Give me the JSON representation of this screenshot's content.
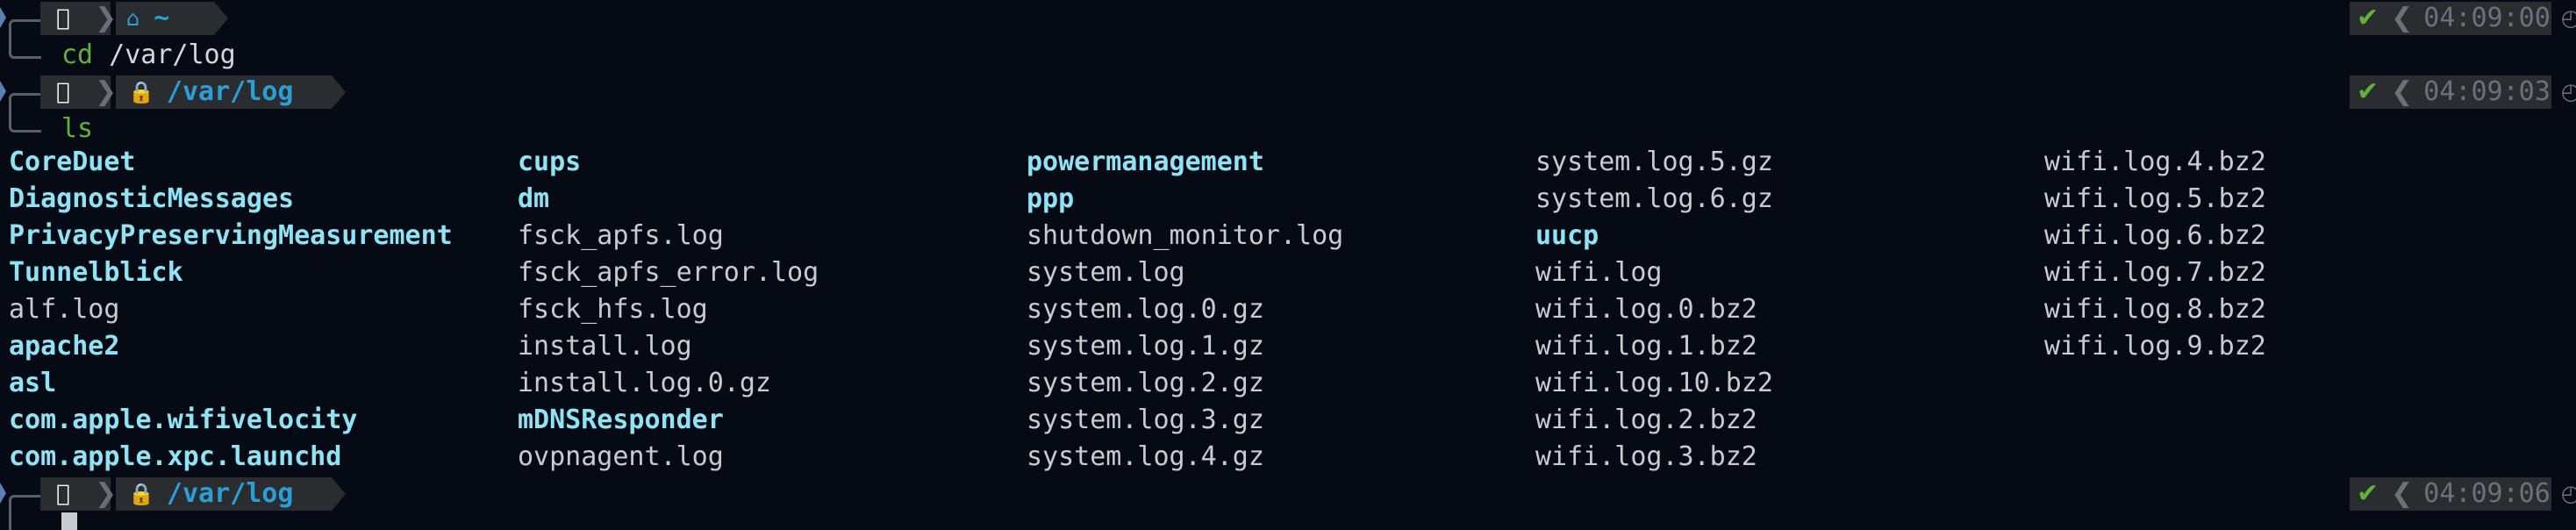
{
  "prompts": [
    {
      "apple_icon": "",
      "dir_icon": "home-icon",
      "path": "~",
      "command": "cd",
      "args": " /var/log",
      "status_icon": "✔",
      "time": "04:09:00",
      "time_icon": "clock-icon"
    },
    {
      "apple_icon": "",
      "dir_icon": "lock-icon",
      "path": "/var/log",
      "command": "ls",
      "args": "",
      "status_icon": "✔",
      "time": "04:09:03",
      "time_icon": "clock-icon"
    },
    {
      "apple_icon": "",
      "dir_icon": "lock-icon",
      "path": "/var/log",
      "command": "",
      "args": "",
      "status_icon": "✔",
      "time": "04:09:06",
      "time_icon": "clock-icon"
    }
  ],
  "ls_output": {
    "columns": [
      [
        {
          "name": "CoreDuet",
          "type": "dir"
        },
        {
          "name": "DiagnosticMessages",
          "type": "dir"
        },
        {
          "name": "PrivacyPreservingMeasurement",
          "type": "dir"
        },
        {
          "name": "Tunnelblick",
          "type": "dir"
        },
        {
          "name": "alf.log",
          "type": "file"
        },
        {
          "name": "apache2",
          "type": "dir"
        },
        {
          "name": "asl",
          "type": "dir"
        },
        {
          "name": "com.apple.wifivelocity",
          "type": "dir"
        },
        {
          "name": "com.apple.xpc.launchd",
          "type": "dir"
        }
      ],
      [
        {
          "name": "cups",
          "type": "dir"
        },
        {
          "name": "dm",
          "type": "dir"
        },
        {
          "name": "fsck_apfs.log",
          "type": "file"
        },
        {
          "name": "fsck_apfs_error.log",
          "type": "file"
        },
        {
          "name": "fsck_hfs.log",
          "type": "file"
        },
        {
          "name": "install.log",
          "type": "file"
        },
        {
          "name": "install.log.0.gz",
          "type": "file"
        },
        {
          "name": "mDNSResponder",
          "type": "dir"
        },
        {
          "name": "ovpnagent.log",
          "type": "file"
        }
      ],
      [
        {
          "name": "powermanagement",
          "type": "dir"
        },
        {
          "name": "ppp",
          "type": "dir"
        },
        {
          "name": "shutdown_monitor.log",
          "type": "file"
        },
        {
          "name": "system.log",
          "type": "file"
        },
        {
          "name": "system.log.0.gz",
          "type": "file"
        },
        {
          "name": "system.log.1.gz",
          "type": "file"
        },
        {
          "name": "system.log.2.gz",
          "type": "file"
        },
        {
          "name": "system.log.3.gz",
          "type": "file"
        },
        {
          "name": "system.log.4.gz",
          "type": "file"
        }
      ],
      [
        {
          "name": "system.log.5.gz",
          "type": "file"
        },
        {
          "name": "system.log.6.gz",
          "type": "file"
        },
        {
          "name": "uucp",
          "type": "dir"
        },
        {
          "name": "wifi.log",
          "type": "file"
        },
        {
          "name": "wifi.log.0.bz2",
          "type": "file"
        },
        {
          "name": "wifi.log.1.bz2",
          "type": "file"
        },
        {
          "name": "wifi.log.10.bz2",
          "type": "file"
        },
        {
          "name": "wifi.log.2.bz2",
          "type": "file"
        },
        {
          "name": "wifi.log.3.bz2",
          "type": "file"
        }
      ],
      [
        {
          "name": "wifi.log.4.bz2",
          "type": "file"
        },
        {
          "name": "wifi.log.5.bz2",
          "type": "file"
        },
        {
          "name": "wifi.log.6.bz2",
          "type": "file"
        },
        {
          "name": "wifi.log.7.bz2",
          "type": "file"
        },
        {
          "name": "wifi.log.8.bz2",
          "type": "file"
        },
        {
          "name": "wifi.log.9.bz2",
          "type": "file"
        }
      ]
    ]
  },
  "colors": {
    "background": "#060a14",
    "directory": "#8ee4f5",
    "file": "#c8cbd0",
    "path": "#2a9fd6",
    "command": "#5fb336",
    "status_ok": "#5fb336",
    "segment_bg": "#2a2c30"
  }
}
